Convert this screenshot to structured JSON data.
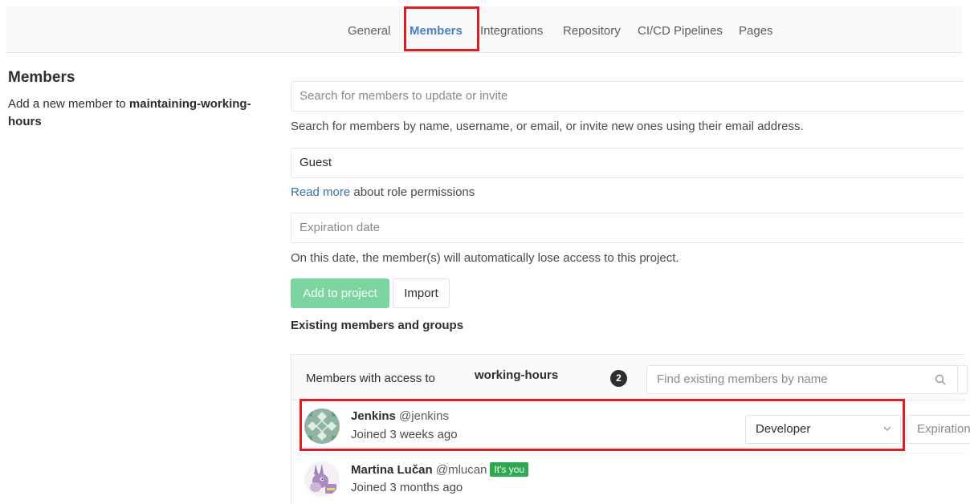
{
  "nav": {
    "tabs": [
      {
        "label": "General",
        "active": false
      },
      {
        "label": "Members",
        "active": true
      },
      {
        "label": "Integrations",
        "active": false
      },
      {
        "label": "Repository",
        "active": false
      },
      {
        "label": "CI/CD Pipelines",
        "active": false
      },
      {
        "label": "Pages",
        "active": false
      }
    ]
  },
  "section": {
    "title": "Members",
    "desc_prefix": "Add a new member to ",
    "project_name": "maintaining-working-hours"
  },
  "invite": {
    "search_placeholder": "Search for members to update or invite",
    "search_help": "Search for members by name, username, or email, or invite new ones using their email address.",
    "role_value": "Guest",
    "read_more_link": "Read more",
    "read_more_suffix": " about role permissions",
    "expiration_placeholder": "Expiration date",
    "expiration_help": "On this date, the member(s) will automatically lose access to this project.",
    "add_button": "Add to project",
    "import_button": "Import"
  },
  "existing": {
    "title": "Existing members and groups",
    "members_with_access": "Members with access to",
    "project_label": "working-hours",
    "count": "2",
    "find_placeholder": "Find existing members by name",
    "members": [
      {
        "name": "Jenkins",
        "username": "@jenkins",
        "joined": "Joined 3 weeks ago",
        "role": "Developer",
        "expiration": "Expiration date",
        "is_you": false
      },
      {
        "name": "Martina Lučan",
        "username": "@mlucan",
        "joined": "Joined 3 months ago",
        "is_you": true,
        "you_badge": "It's you"
      }
    ]
  },
  "colors": {
    "accent": "#4a7fc8",
    "highlight": "#e31b23",
    "add_button": "#7cd4a0",
    "you_badge": "#2fa84f"
  }
}
